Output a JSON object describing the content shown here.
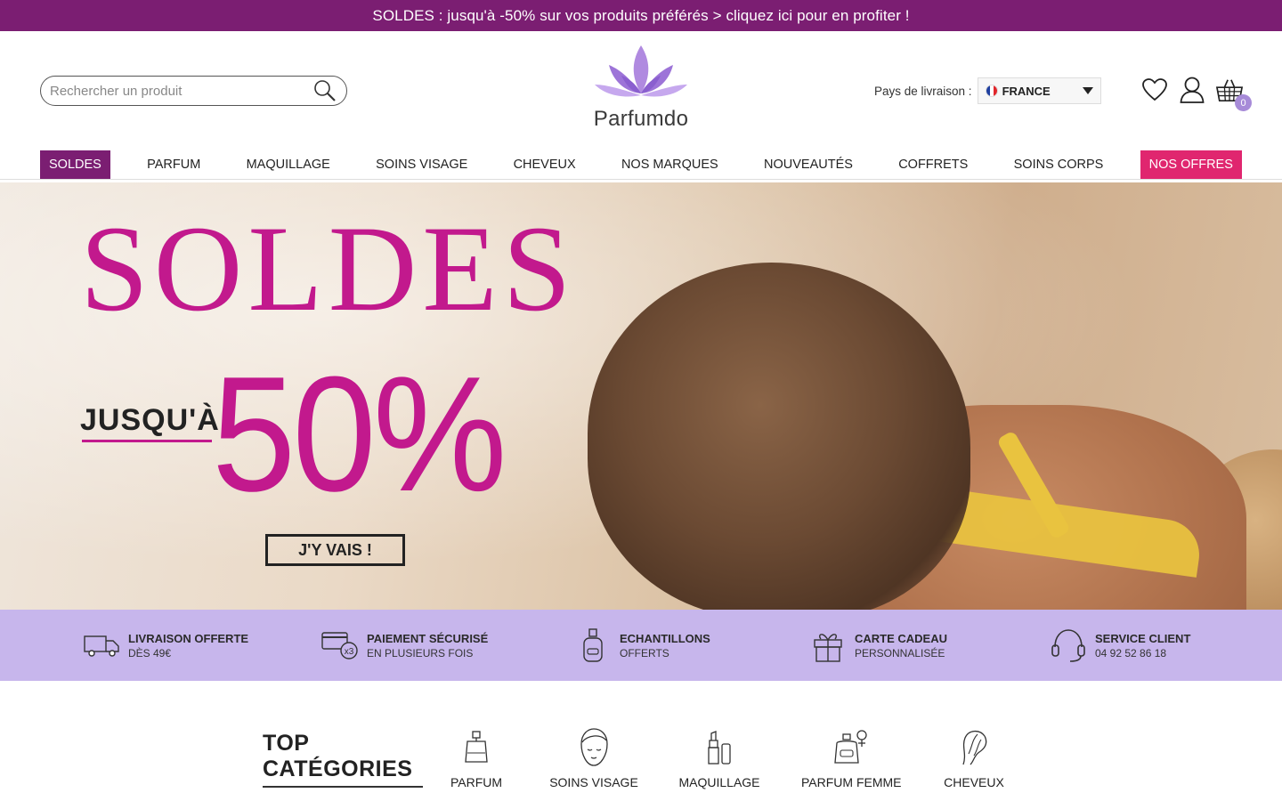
{
  "promo": {
    "text": "SOLDES : jusqu'à -50% sur vos produits préférés > cliquez ici pour en profiter !"
  },
  "header": {
    "search_placeholder": "Rechercher un produit",
    "logo_text": "Parfumdo",
    "shipping_label": "Pays de livraison :",
    "country": "FRANCE",
    "cart_count": "0"
  },
  "nav": {
    "items": [
      "SOLDES",
      "PARFUM",
      "MAQUILLAGE",
      "SOINS VISAGE",
      "CHEVEUX",
      "NOS MARQUES",
      "NOUVEAUTÉS",
      "COFFRETS",
      "SOINS CORPS",
      "NOS OFFRES"
    ]
  },
  "hero": {
    "title": "SOLDES",
    "upto": "JUSQU'À",
    "percent": "50%",
    "cta": "J'Y VAIS !"
  },
  "benefits": [
    {
      "icon": "truck-icon",
      "title": "LIVRAISON OFFERTE",
      "sub": "DÈS 49€"
    },
    {
      "icon": "card-payment-icon",
      "title": "PAIEMENT SÉCURISÉ",
      "sub": "EN PLUSIEURS FOIS"
    },
    {
      "icon": "perfume-sample-icon",
      "title": "ECHANTILLONS",
      "sub": "OFFERTS"
    },
    {
      "icon": "gift-icon",
      "title": "CARTE CADEAU",
      "sub": "PERSONNALISÉE"
    },
    {
      "icon": "headset-icon",
      "title": "SERVICE CLIENT",
      "sub": "04 92 52 86 18"
    }
  ],
  "top_categories": {
    "title_line1": "TOP",
    "title_line2": "CATÉGORIES",
    "items": [
      {
        "icon": "perfume-bottle-icon",
        "label": "PARFUM"
      },
      {
        "icon": "face-care-icon",
        "label": "SOINS VISAGE"
      },
      {
        "icon": "lipstick-icon",
        "label": "MAQUILLAGE"
      },
      {
        "icon": "women-perfume-icon",
        "label": "PARFUM FEMME"
      },
      {
        "icon": "hair-icon",
        "label": "CHEVEUX"
      }
    ]
  },
  "colors": {
    "brand_purple": "#7b1e72",
    "hero_pink": "#c2198d",
    "offers_pink": "#e0266f",
    "benefits_bg": "#c7b6ec"
  }
}
